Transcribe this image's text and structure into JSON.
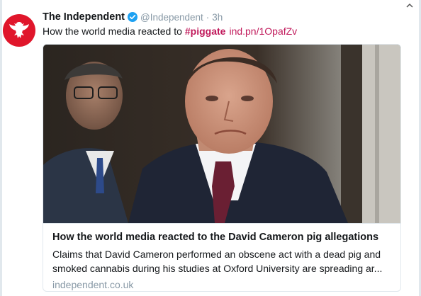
{
  "tweet": {
    "author_name": "The Independent",
    "handle": "@Independent",
    "separator": "·",
    "timestamp": "3h",
    "text_prefix": "How the world media reacted to",
    "hashtag": "#piggate",
    "link": "ind.pn/1OpafZv"
  },
  "card": {
    "title": "How the world media reacted to the David Cameron pig allegations",
    "description": "Claims that David Cameron performed an obscene act with a dead pig and smoked cannabis during his studies at Oxford University are spreading ar...",
    "domain": "independent.co.uk"
  },
  "colors": {
    "brand_red": "#e0162b",
    "link_color": "#c0185a",
    "verified_blue": "#1da1f2",
    "meta_gray": "#8899a6"
  },
  "icons": {
    "avatar": "independent-eagle-logo",
    "verified": "verified-badge-icon",
    "scroll": "chevron-up-icon"
  }
}
